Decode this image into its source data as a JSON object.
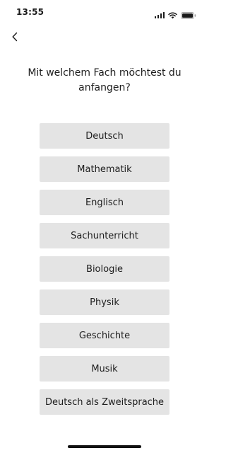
{
  "status_bar": {
    "time": "13:55"
  },
  "nav": {
    "back_icon": "chevron-left-icon"
  },
  "prompt": "Mit welchem Fach möchtest du anfangen?",
  "subjects": [
    {
      "label": "Deutsch"
    },
    {
      "label": "Mathematik"
    },
    {
      "label": "Englisch"
    },
    {
      "label": "Sachunterricht"
    },
    {
      "label": "Biologie"
    },
    {
      "label": "Physik"
    },
    {
      "label": "Geschichte"
    },
    {
      "label": "Musik"
    },
    {
      "label": "Deutsch als Zweitsprache"
    }
  ],
  "colors": {
    "button_background": "#e4e4e4",
    "text": "#1e1e1e",
    "background": "#ffffff"
  }
}
